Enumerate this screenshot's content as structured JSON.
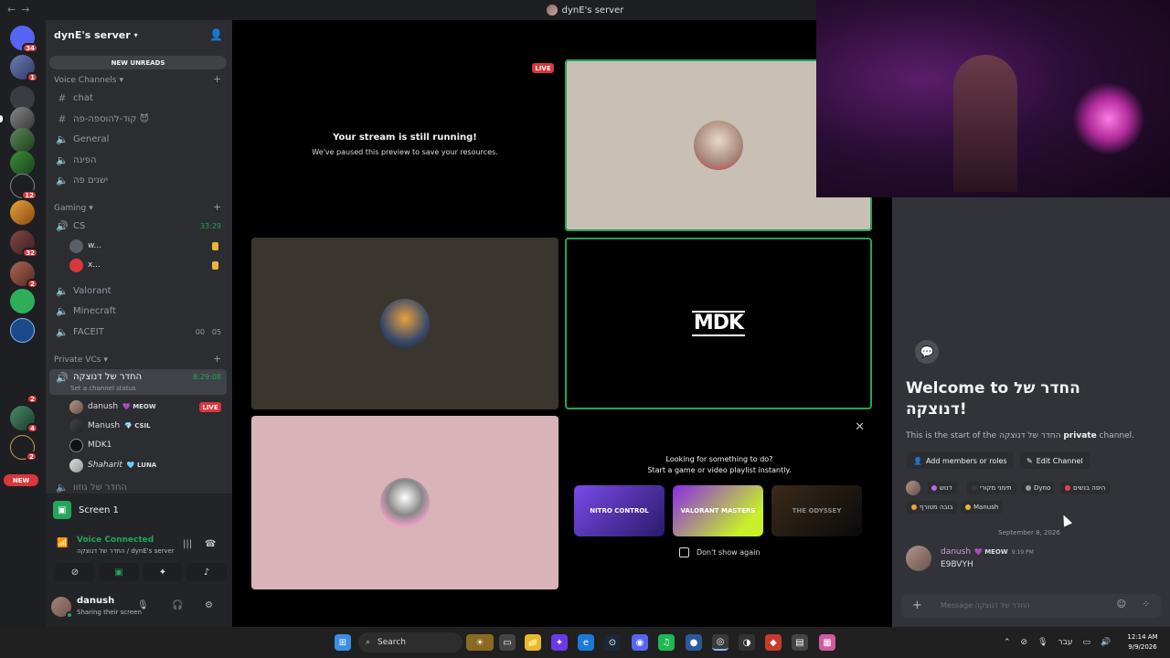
{
  "window": {
    "title": "dynE's server"
  },
  "rail": {
    "badges": [
      "34",
      "1",
      "12",
      "32",
      "2",
      "2",
      "4",
      "2"
    ],
    "new_label": "NEW"
  },
  "sidebar": {
    "server_name": "dynE's server",
    "new_unreads": "NEW UNREADS",
    "categories": {
      "voice": "Voice Channels",
      "gaming": "Gaming",
      "private": "Private VCs"
    },
    "voice_channels": [
      "chat",
      "קוד-להוספה-פה 😈",
      "General",
      "הפינה",
      "ישנים פה"
    ],
    "gaming_channels": {
      "cs": "CS",
      "cs_timer": "33:29",
      "cs_users": [
        "w...",
        "x..."
      ],
      "valorant": "Valorant",
      "minecraft": "Minecraft",
      "faceit": "FACEIT",
      "faceit_count_a": "00",
      "faceit_count_b": "05"
    },
    "private": {
      "channel": "החדר של דנוצקה",
      "timer": "8:29:08",
      "status_hint": "Set a channel status",
      "users": [
        {
          "name": "danush",
          "tag": "MEOW",
          "live": "LIVE"
        },
        {
          "name": "Manush",
          "tag": "CSIL"
        },
        {
          "name": "MDK1",
          "tag": ""
        },
        {
          "name": "Shaharit",
          "tag": "LUNA"
        }
      ],
      "next_channel": "החדר של גוזוו"
    }
  },
  "bottom": {
    "screen_label": "Screen 1",
    "voice_connected": "Voice Connected",
    "voice_sub": "החדר של דנוצקה / dynE's server",
    "user_name": "danush",
    "user_status": "Sharing their screen"
  },
  "stage": {
    "live_label": "LIVE",
    "stream_title": "Your stream is still running!",
    "stream_sub": "We've paused this preview to save your resources.",
    "mdk_logo": "MDK",
    "activity_line1": "Looking for something to do?",
    "activity_line2": "Start a game or video playlist instantly.",
    "games": [
      "NITRO CONTROL",
      "VALORANT MASTERS",
      "THE ODYSSEY"
    ],
    "dont_show": "Don't show again"
  },
  "chat": {
    "welcome": "Welcome to החדר של דנוצקה!",
    "start_prefix": "This is the start of the ",
    "start_channel": "החדר של דנוצקה",
    "start_private": "private",
    "start_suffix": " channel.",
    "add_members": "Add members or roles",
    "edit_channel": "Edit Channel",
    "roles": [
      "דנוש",
      "תימני מקורי",
      "Dyno",
      "היפה בנשים",
      "בובה מטורף",
      "Manush"
    ],
    "role_colors": [
      "#b66ee8",
      "#3a3a3a",
      "#949ba4",
      "#f23f43",
      "#f0a232",
      "#f0b232"
    ],
    "date_divider": "September 8, 2026",
    "message": {
      "author": "danush",
      "tag": "MEOW",
      "time": "9:19 PM",
      "text": "E9BVYH"
    },
    "composer_placeholder": "Message החדר של דנוצקה"
  },
  "taskbar": {
    "search": "Search",
    "lang": "עבר",
    "time": "12:14 AM",
    "date": "9/9/2026"
  },
  "colors": {
    "accent_green": "#23a55a",
    "live_red": "#da373c",
    "bg_sidebar": "#2b2d31",
    "bg_chat": "#313338"
  }
}
